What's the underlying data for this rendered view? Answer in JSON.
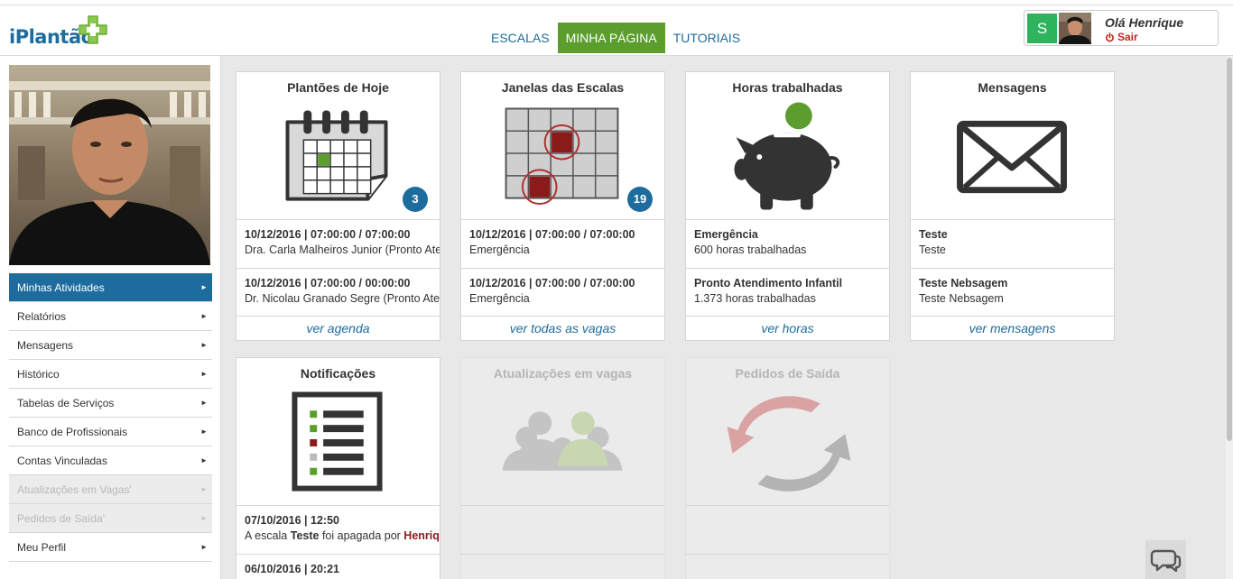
{
  "brand": {
    "logo_text": "iPlantão"
  },
  "nav": [
    {
      "label": "ESCALAS",
      "active": false
    },
    {
      "label": "MINHA PÁGINA",
      "active": true
    },
    {
      "label": "TUTORIAIS",
      "active": false
    }
  ],
  "user": {
    "initial": "S",
    "greeting": "Olá Henrique",
    "logout": "Sair"
  },
  "sidebar": {
    "items": [
      {
        "label": "Minhas Atividades",
        "state": "active"
      },
      {
        "label": "Relatórios",
        "state": "normal"
      },
      {
        "label": "Mensagens",
        "state": "normal"
      },
      {
        "label": "Histórico",
        "state": "normal"
      },
      {
        "label": "Tabelas de Serviços",
        "state": "normal"
      },
      {
        "label": "Banco de Profissionais",
        "state": "normal"
      },
      {
        "label": "Contas Vinculadas",
        "state": "normal"
      },
      {
        "label": "Atualizações em Vagas'",
        "state": "disabled"
      },
      {
        "label": "Pedidos de Saída'",
        "state": "disabled"
      },
      {
        "label": "Meu Perfil",
        "state": "normal"
      }
    ]
  },
  "cards": {
    "plantoes": {
      "title": "Plantões de Hoje",
      "badge": "3",
      "rows": [
        {
          "line1": "10/12/2016 | 07:00:00 / 07:00:00",
          "line2": "Dra. Carla Malheiros Junior (Pronto Atendimento)"
        },
        {
          "line1": "10/12/2016 | 07:00:00 / 00:00:00",
          "line2": "Dr. Nicolau Granado Segre (Pronto Atendimento)"
        }
      ],
      "link": "ver agenda"
    },
    "janelas": {
      "title": "Janelas das Escalas",
      "badge": "19",
      "rows": [
        {
          "line1": "10/12/2016 | 07:00:00 / 07:00:00",
          "line2": "Emergência"
        },
        {
          "line1": "10/12/2016 | 07:00:00 / 07:00:00",
          "line2": "Emergência"
        }
      ],
      "link": "ver todas as vagas"
    },
    "horas": {
      "title": "Horas trabalhadas",
      "rows": [
        {
          "line1": "Emergência",
          "line2": "600 horas trabalhadas"
        },
        {
          "line1": "Pronto Atendimento Infantil",
          "line2": "1.373 horas trabalhadas"
        }
      ],
      "link": "ver horas"
    },
    "mensagens": {
      "title": "Mensagens",
      "rows": [
        {
          "line1": "Teste",
          "line2": "Teste"
        },
        {
          "line1": "Teste Nebsagem",
          "line2": "Teste Nebsagem"
        }
      ],
      "link": "ver mensagens"
    },
    "notificacoes": {
      "title": "Notificações",
      "rows": [
        {
          "line1": "07/10/2016 | 12:50",
          "pre": "A escala ",
          "bold": "Teste",
          "mid": " foi apagada por ",
          "red": "Henrique"
        },
        {
          "line1": "06/10/2016 | 20:21"
        }
      ]
    },
    "atualizacoes": {
      "title": "Atualizações em vagas"
    },
    "pedidos": {
      "title": "Pedidos de Saída"
    }
  },
  "colors": {
    "brand_blue": "#1d6c9d",
    "brand_green": "#5b9e2e",
    "alert_red": "#8b1a1a"
  },
  "icons": [
    "calendar-icon",
    "schedule-grid-icon",
    "piggy-bank-icon",
    "envelope-icon",
    "checklist-icon",
    "people-icon",
    "exchange-arrows-icon",
    "chat-icon",
    "power-icon",
    "medical-cross-icon"
  ]
}
